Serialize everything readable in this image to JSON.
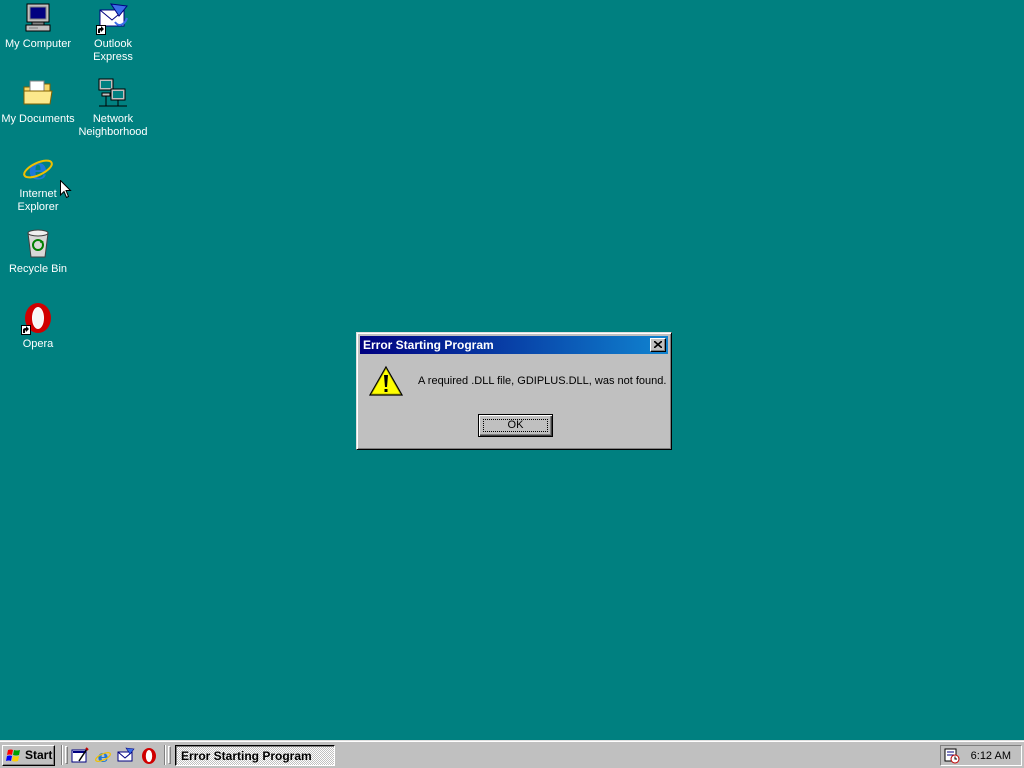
{
  "desktop": {
    "background_color": "#008080",
    "icons": [
      {
        "label": "My Computer",
        "icon": "my-computer-icon"
      },
      {
        "label": "Outlook\nExpress",
        "icon": "outlook-express-icon",
        "shortcut": true
      },
      {
        "label": "My Documents",
        "icon": "my-documents-icon"
      },
      {
        "label": "Network\nNeighborhood",
        "icon": "network-neighborhood-icon"
      },
      {
        "label": "Internet\nExplorer",
        "icon": "internet-explorer-icon"
      },
      {
        "label": "Recycle Bin",
        "icon": "recycle-bin-icon"
      },
      {
        "label": "Opera",
        "icon": "opera-icon",
        "shortcut": true
      }
    ]
  },
  "dialog": {
    "title": "Error Starting Program",
    "message": "A required .DLL file, GDIPLUS.DLL, was not found.",
    "icon": "warning-icon",
    "ok_label": "OK",
    "close_icon": "close-icon"
  },
  "taskbar": {
    "start_label": "Start",
    "quick_launch": [
      "desktop-icon",
      "internet-explorer-icon",
      "outlook-express-icon",
      "opera-icon"
    ],
    "task_button_label": "Error Starting Program",
    "tray_icon": "scheduler-icon",
    "clock": "6:12 AM"
  },
  "colors": {
    "titlebar_start": "#000080",
    "titlebar_end": "#1084d0",
    "face": "#c0c0c0"
  }
}
